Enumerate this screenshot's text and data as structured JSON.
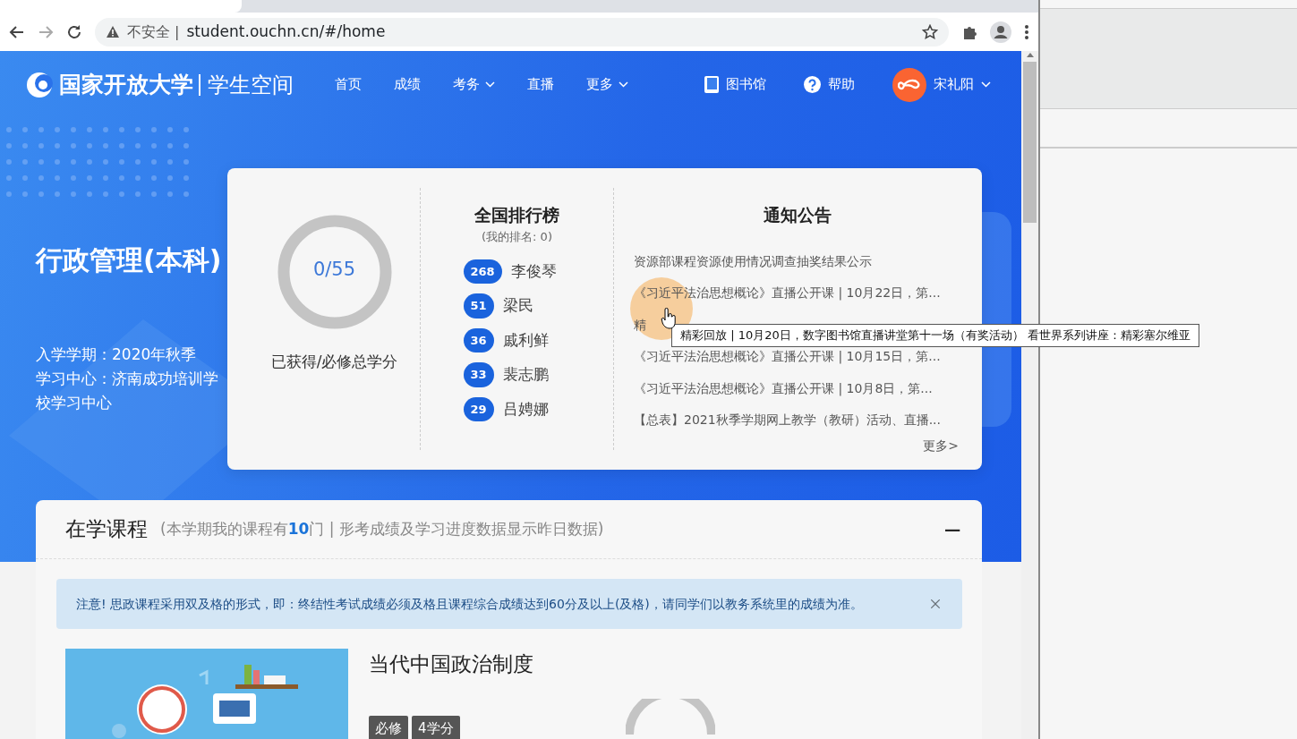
{
  "browser": {
    "security_label": "不安全 |",
    "url": "student.ouchn.cn/#/home"
  },
  "header": {
    "logo_text": "国家开放大学",
    "logo_sub": "学生空间",
    "nav": [
      {
        "label": "首页",
        "dropdown": false
      },
      {
        "label": "成绩",
        "dropdown": false
      },
      {
        "label": "考务",
        "dropdown": true
      },
      {
        "label": "直播",
        "dropdown": false
      },
      {
        "label": "更多",
        "dropdown": true
      }
    ],
    "library": "图书馆",
    "help": "帮助",
    "user": "宋礼阳"
  },
  "program": {
    "title": "行政管理(本科)",
    "info": [
      "入学学期：2020年秋季",
      "学习中心：济南成功培训学校学习中心"
    ]
  },
  "credits": {
    "reading": "0/55",
    "level": 0,
    "caption": "已获得/必修总学分"
  },
  "ranking": {
    "title": "全国排行榜",
    "subtitle": "(我的排名: 0)",
    "rows": [
      {
        "score": "268",
        "name": "李俊琴"
      },
      {
        "score": "51",
        "name": "梁民"
      },
      {
        "score": "36",
        "name": "戚利鲜"
      },
      {
        "score": "33",
        "name": "裴志鹏"
      },
      {
        "score": "29",
        "name": "吕娉娜"
      }
    ]
  },
  "notices": {
    "title": "通知公告",
    "items": [
      "资源部课程资源使用情况调查抽奖结果公示",
      "《习近平法治思想概论》直播公开课 | 10月22日，第...",
      "精",
      "《习近平法治思想概论》直播公开课 | 10月15日，第...",
      "《习近平法治思想概论》直播公开课 | 10月8日，第...",
      "【总表】2021秋季学期网上教学（教研）活动、直播..."
    ],
    "more": "更多>"
  },
  "tooltip": "精彩回放 | 10月20日，数字图书馆直播讲堂第十一场（有奖活动） 看世界系列讲座：精彩塞尔维亚",
  "courses": {
    "title": "在学课程",
    "summary": "(本学期我的课程有**10**门 | 形考成绩及学习进度数据显示昨日数据)",
    "collapse": "−",
    "alert": "注意! 思政课程采用双及格的形式，即：终结性考试成绩必须及格且课程综合成绩达到60分及以上(及格)，请同学们以教务系统里的成绩为准。",
    "items": [
      {
        "name": "当代中国政治制度",
        "tags": [
          "必修",
          "4学分"
        ]
      }
    ]
  }
}
